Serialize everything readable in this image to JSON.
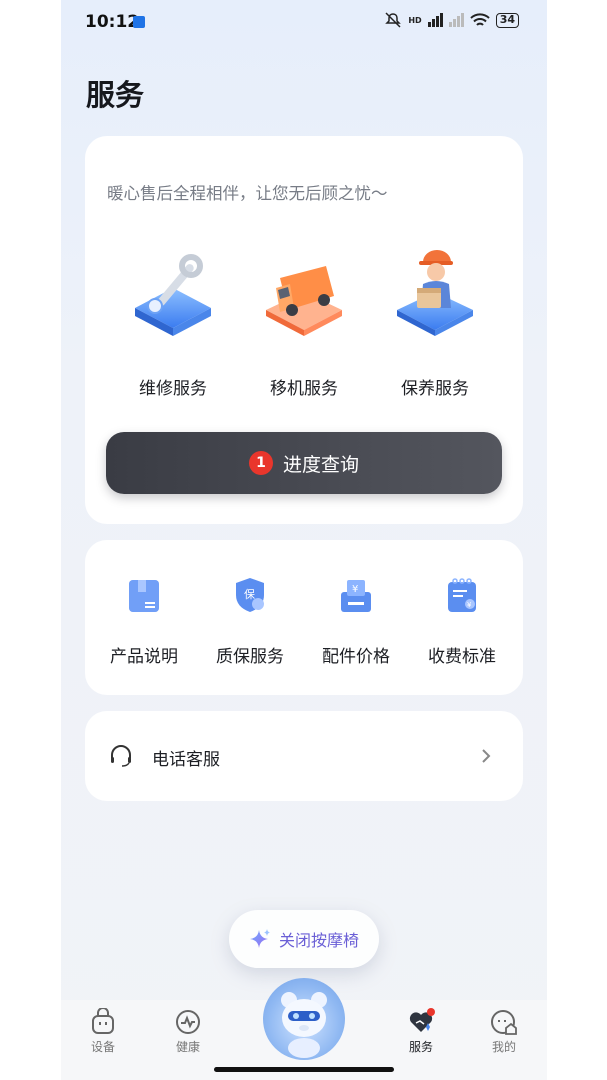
{
  "status_bar": {
    "time": "10:12",
    "hd_label": "HD",
    "battery": "34"
  },
  "page": {
    "title": "服务"
  },
  "main_card": {
    "slogan": "暖心售后全程相伴，让您无后顾之忧～",
    "services": [
      {
        "label": "维修服务",
        "icon": "wrench-icon"
      },
      {
        "label": "移机服务",
        "icon": "truck-icon"
      },
      {
        "label": "保养服务",
        "icon": "worker-icon"
      }
    ],
    "progress_button": {
      "badge": "1",
      "label": "进度查询"
    }
  },
  "info_card": {
    "items": [
      {
        "label": "产品说明",
        "icon": "manual-icon"
      },
      {
        "label": "质保服务",
        "icon": "warranty-shield-icon",
        "icon_text": "保"
      },
      {
        "label": "配件价格",
        "icon": "parts-price-icon",
        "icon_text": "¥"
      },
      {
        "label": "收费标准",
        "icon": "fee-standard-icon",
        "icon_text": "¥"
      }
    ]
  },
  "support_card": {
    "label": "电话客服",
    "icon": "headset-icon"
  },
  "floating_button": {
    "label": "关闭按摩椅",
    "icon": "sparkle-icon"
  },
  "tab_bar": {
    "tabs": [
      {
        "label": "设备",
        "icon": "device-icon",
        "active": false
      },
      {
        "label": "健康",
        "icon": "health-icon",
        "active": false
      },
      {
        "label": "",
        "icon": "mascot-bear-icon",
        "active": false
      },
      {
        "label": "服务",
        "icon": "service-heart-icon",
        "active": true
      },
      {
        "label": "我的",
        "icon": "profile-icon",
        "active": false
      }
    ]
  },
  "colors": {
    "accent_blue": "#3b7cf0",
    "button_dark": "#3a3c44",
    "badge_red": "#e9362c",
    "float_text": "#6a5fd6"
  }
}
